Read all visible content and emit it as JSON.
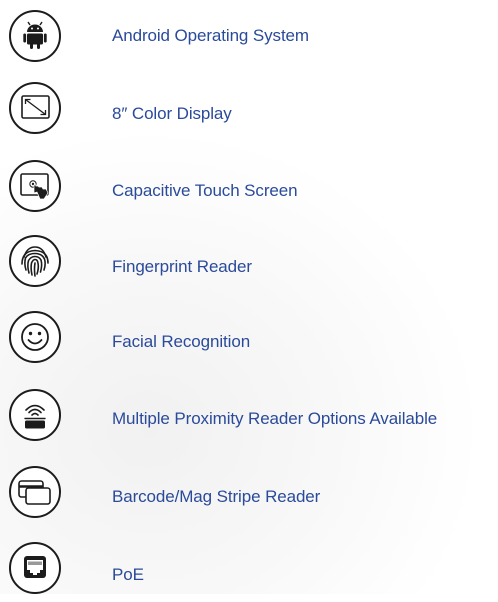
{
  "features": [
    {
      "label": "Android Operating System",
      "icon": "android-icon"
    },
    {
      "label": "8″ Color Display",
      "icon": "display-resize-icon"
    },
    {
      "label": "Capacitive Touch Screen",
      "icon": "touch-screen-icon"
    },
    {
      "label": "Fingerprint Reader",
      "icon": "fingerprint-icon"
    },
    {
      "label": "Facial Recognition",
      "icon": "smiley-face-icon"
    },
    {
      "label": "Multiple Proximity Reader Options Available",
      "icon": "proximity-reader-icon"
    },
    {
      "label": "Barcode/Mag Stripe Reader",
      "icon": "cards-icon"
    },
    {
      "label": "PoE",
      "icon": "ethernet-port-icon"
    }
  ],
  "colors": {
    "label_text": "#2a4a9a",
    "icon_stroke": "#1c1c1c"
  }
}
